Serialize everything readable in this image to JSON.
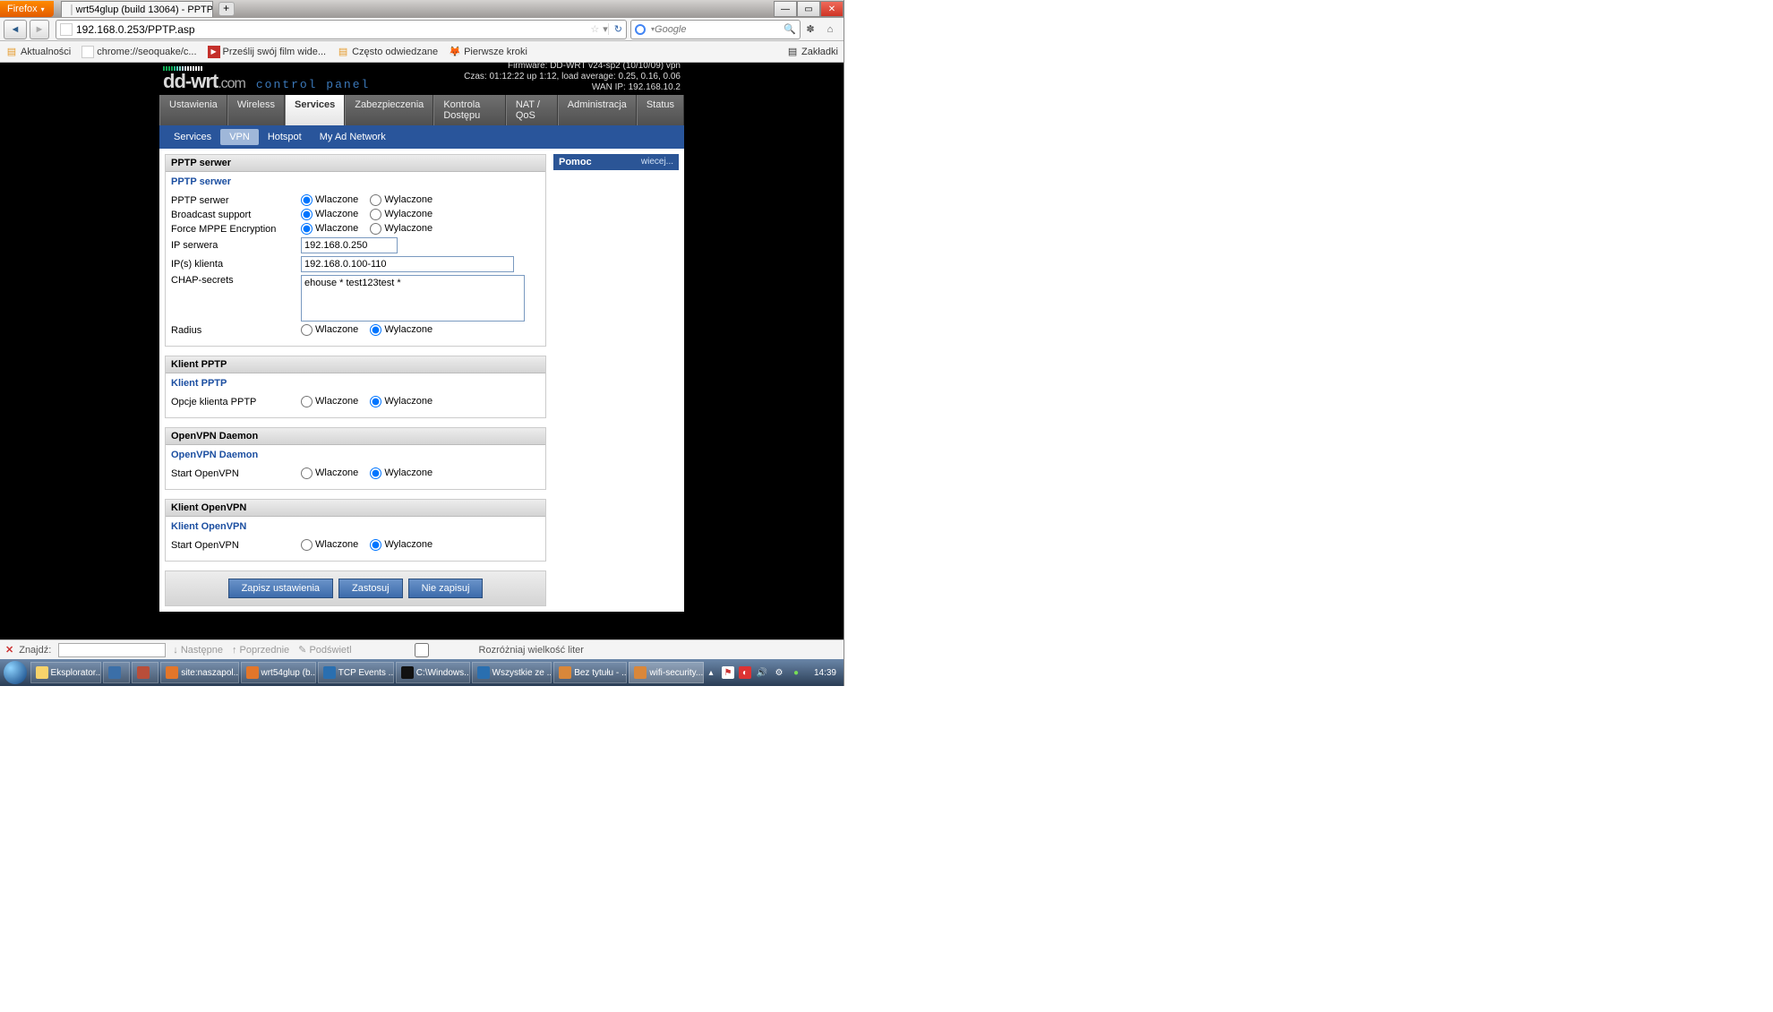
{
  "browser": {
    "name": "Firefox",
    "tab_title": "wrt54glup (build 13064) - PPTP",
    "url": "192.168.0.253/PPTP.asp",
    "search_placeholder": "Google",
    "bookmarks": [
      "Aktualności",
      "chrome://seoquake/c...",
      "Prześlij swój film wide...",
      "Często odwiedzane",
      "Pierwsze kroki"
    ],
    "bookmarks_btn": "Zakładki"
  },
  "header": {
    "control_panel": "control panel",
    "firmware": "Firmware: DD-WRT v24-sp2 (10/10/09) vpn",
    "time": "Czas: 01:12:22 up 1:12, load average: 0.25, 0.16, 0.06",
    "wanip": "WAN IP: 192.168.10.2"
  },
  "main_tabs": [
    "Ustawienia",
    "Wireless",
    "Services",
    "Zabezpieczenia",
    "Kontrola Dostępu",
    "NAT / QoS",
    "Administracja",
    "Status"
  ],
  "main_tab_active": 2,
  "sub_tabs": [
    "Services",
    "VPN",
    "Hotspot",
    "My Ad Network"
  ],
  "sub_tab_active": 1,
  "labels": {
    "on": "Wlaczone",
    "off": "Wylaczone",
    "pptp_server_section": "PPTP serwer",
    "pptp_server_sub": "PPTP serwer",
    "pptp_server": "PPTP serwer",
    "broadcast": "Broadcast support",
    "mppe": "Force MPPE Encryption",
    "server_ip": "IP serwera",
    "client_ips": "IP(s) klienta",
    "chap": "CHAP-secrets",
    "radius": "Radius",
    "klient_pptp_section": "Klient PPTP",
    "klient_pptp_sub": "Klient PPTP",
    "klient_pptp_opt": "Opcje klienta PPTP",
    "openvpn_section": "OpenVPN Daemon",
    "openvpn_sub": "OpenVPN Daemon",
    "openvpn_start": "Start OpenVPN",
    "klient_openvpn_section": "Klient OpenVPN",
    "klient_openvpn_sub": "Klient OpenVPN",
    "klient_openvpn_start": "Start OpenVPN",
    "help": "Pomoc",
    "help_more": "wiecej..."
  },
  "values": {
    "server_ip": "192.168.0.250",
    "client_ips": "192.168.0.100-110",
    "chap_user": "ehouse",
    "chap_rest": " * test123test *"
  },
  "buttons": {
    "save": "Zapisz ustawienia",
    "apply": "Zastosuj",
    "cancel": "Nie zapisuj"
  },
  "findbar": {
    "label": "Znajdź:",
    "next": "Następne",
    "prev": "Poprzednie",
    "highlight": "Podświetl",
    "case": "Rozróżniaj wielkość liter"
  },
  "taskbar": {
    "items": [
      "Eksplorator...",
      "",
      "",
      "site:naszapol...",
      "wrt54glup (b...",
      "TCP Events ...",
      "C:\\Windows...",
      "Wszystkie ze ...",
      "Bez tytułu - ...",
      "wifi-security...."
    ],
    "clock": "14:39"
  }
}
